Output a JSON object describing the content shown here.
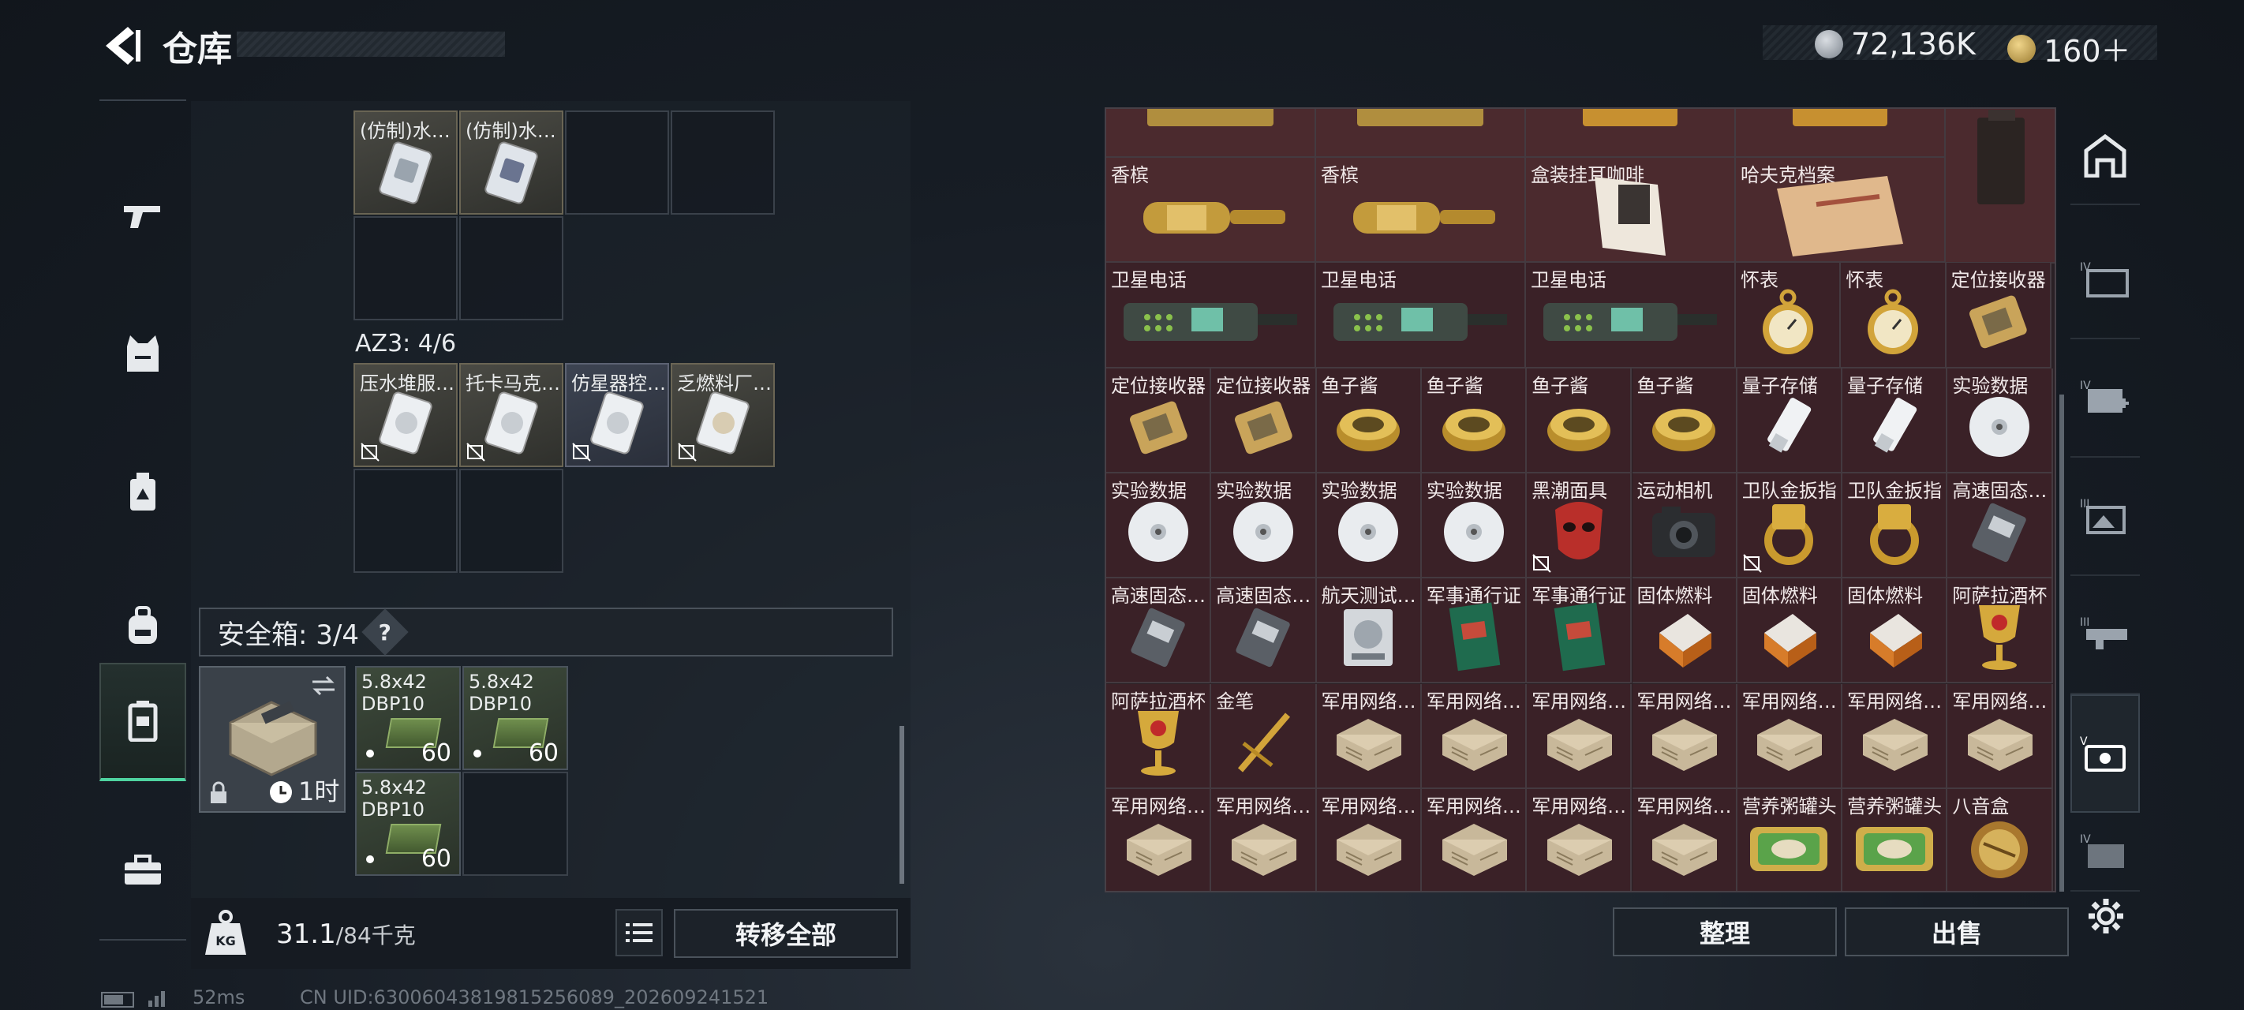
{
  "header": {
    "title": "仓库",
    "coins_value": "72,136K",
    "tokens_value": "160＋"
  },
  "left": {
    "container_items": [
      {
        "label": "(仿制)水…"
      },
      {
        "label": "(仿制)水…"
      }
    ],
    "az3_label": "AZ3: 4/6",
    "az3_items": [
      {
        "label": "压水堆服…"
      },
      {
        "label": "托卡马克…"
      },
      {
        "label": "仿星器控…"
      },
      {
        "label": "乏燃料厂…"
      }
    ],
    "safe_box": {
      "label": "安全箱: 3/4",
      "help": "?",
      "timer": "1时"
    },
    "ammo": [
      {
        "name": "5.8x42 DBP10",
        "count": "60"
      },
      {
        "name": "5.8x42 DBP10",
        "count": "60"
      },
      {
        "name": "5.8x42 DBP10",
        "count": "60"
      }
    ],
    "weight_value": "31.1",
    "weight_max": "/84千克",
    "transfer_all": "转移全部"
  },
  "right": {
    "rows": [
      [
        {
          "label": "香槟",
          "icon": "champagne-icon"
        },
        {
          "label": "香槟",
          "icon": "champagne-icon"
        },
        {
          "label": "盒装挂耳咖啡",
          "icon": "coffee-box-icon"
        },
        {
          "label": "哈夫克档案",
          "icon": "file-icon"
        }
      ],
      [
        {
          "label": "卫星电话",
          "icon": "satphone-icon"
        },
        {
          "label": "卫星电话",
          "icon": "satphone-icon"
        },
        {
          "label": "卫星电话",
          "icon": "satphone-icon"
        },
        {
          "label": "怀表",
          "icon": "pocketwatch-icon"
        },
        {
          "label": "怀表",
          "icon": "pocketwatch-icon"
        },
        {
          "label": "定位接收器",
          "icon": "receiver-icon"
        }
      ],
      [
        {
          "label": "定位接收器",
          "icon": "receiver-icon"
        },
        {
          "label": "定位接收器",
          "icon": "receiver-icon"
        },
        {
          "label": "鱼子酱",
          "icon": "caviar-icon"
        },
        {
          "label": "鱼子酱",
          "icon": "caviar-icon"
        },
        {
          "label": "鱼子酱",
          "icon": "caviar-icon"
        },
        {
          "label": "鱼子酱",
          "icon": "caviar-icon"
        },
        {
          "label": "量子存储",
          "icon": "usb-icon"
        },
        {
          "label": "量子存储",
          "icon": "usb-icon"
        },
        {
          "label": "实验数据",
          "icon": "disc-icon"
        }
      ],
      [
        {
          "label": "实验数据",
          "icon": "disc-icon"
        },
        {
          "label": "实验数据",
          "icon": "disc-icon"
        },
        {
          "label": "实验数据",
          "icon": "disc-icon"
        },
        {
          "label": "实验数据",
          "icon": "disc-icon"
        },
        {
          "label": "黑潮面具",
          "icon": "mask-icon"
        },
        {
          "label": "运动相机",
          "icon": "camera-icon"
        },
        {
          "label": "卫队金扳指",
          "icon": "ring-icon"
        },
        {
          "label": "卫队金扳指",
          "icon": "ring-icon"
        },
        {
          "label": "高速固态…",
          "icon": "ssd-icon"
        }
      ],
      [
        {
          "label": "高速固态…",
          "icon": "ssd-icon"
        },
        {
          "label": "高速固态…",
          "icon": "ssd-icon"
        },
        {
          "label": "航天测试…",
          "icon": "hdd-icon"
        },
        {
          "label": "军事通行证",
          "icon": "passbook-icon"
        },
        {
          "label": "军事通行证",
          "icon": "passbook-icon"
        },
        {
          "label": "固体燃料",
          "icon": "fuel-icon"
        },
        {
          "label": "固体燃料",
          "icon": "fuel-icon"
        },
        {
          "label": "固体燃料",
          "icon": "fuel-icon"
        },
        {
          "label": "阿萨拉酒杯",
          "icon": "goblet-icon"
        }
      ],
      [
        {
          "label": "阿萨拉酒杯",
          "icon": "goblet-icon"
        },
        {
          "label": "金笔",
          "icon": "pen-icon"
        },
        {
          "label": "军用网络…",
          "icon": "netbox-icon"
        },
        {
          "label": "军用网络…",
          "icon": "netbox-icon"
        },
        {
          "label": "军用网络…",
          "icon": "netbox-icon"
        },
        {
          "label": "军用网络…",
          "icon": "netbox-icon"
        },
        {
          "label": "军用网络…",
          "icon": "netbox-icon"
        },
        {
          "label": "军用网络…",
          "icon": "netbox-icon"
        },
        {
          "label": "军用网络…",
          "icon": "netbox-icon"
        }
      ],
      [
        {
          "label": "军用网络…",
          "icon": "netbox-icon"
        },
        {
          "label": "军用网络…",
          "icon": "netbox-icon"
        },
        {
          "label": "军用网络…",
          "icon": "netbox-icon"
        },
        {
          "label": "军用网络…",
          "icon": "netbox-icon"
        },
        {
          "label": "军用网络…",
          "icon": "netbox-icon"
        },
        {
          "label": "军用网络…",
          "icon": "netbox-icon"
        },
        {
          "label": "营养粥罐头",
          "icon": "can-icon"
        },
        {
          "label": "营养粥罐头",
          "icon": "can-icon"
        },
        {
          "label": "八音盒",
          "icon": "musicbox-icon"
        }
      ]
    ],
    "sort_label": "整理",
    "sell_label": "出售"
  },
  "status": {
    "ping": "52ms",
    "uid": "CN UID:6300604381981525608​9_202609241521"
  }
}
